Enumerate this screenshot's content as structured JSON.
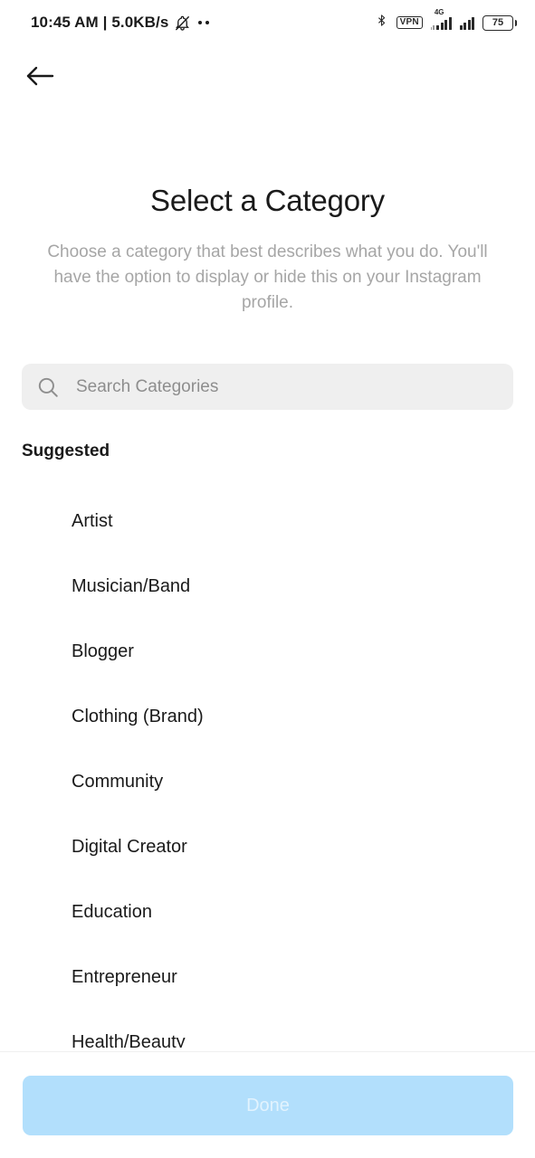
{
  "status_bar": {
    "time": "10:45 AM",
    "separator": "|",
    "network_speed": "5.0KB/s",
    "notification_icon": "bell-mute-icon",
    "overflow_dots": "••",
    "bluetooth_icon": "bluetooth-icon",
    "vpn_label": "VPN",
    "network_type": "4G",
    "signal_icon_1": "signal-bars-icon",
    "signal_icon_2": "signal-bars-icon",
    "battery_level": "75"
  },
  "header": {
    "back_icon": "back-arrow-icon"
  },
  "page": {
    "title": "Select a Category",
    "subtitle": "Choose a category that best describes what you do. You'll have the option to display or hide this on your Instagram profile."
  },
  "search": {
    "icon": "search-icon",
    "placeholder": "Search Categories",
    "value": ""
  },
  "list": {
    "section_label": "Suggested",
    "items": [
      {
        "label": "Artist"
      },
      {
        "label": "Musician/Band"
      },
      {
        "label": "Blogger"
      },
      {
        "label": "Clothing (Brand)"
      },
      {
        "label": "Community"
      },
      {
        "label": "Digital Creator"
      },
      {
        "label": "Education"
      },
      {
        "label": "Entrepreneur"
      },
      {
        "label": "Health/Beauty"
      }
    ]
  },
  "footer": {
    "done_label": "Done",
    "done_enabled": false
  },
  "colors": {
    "accent_disabled": "#b2dffc",
    "search_bg": "#efefef",
    "text_primary": "#1a1a1a",
    "text_muted": "#a6a6a6"
  }
}
